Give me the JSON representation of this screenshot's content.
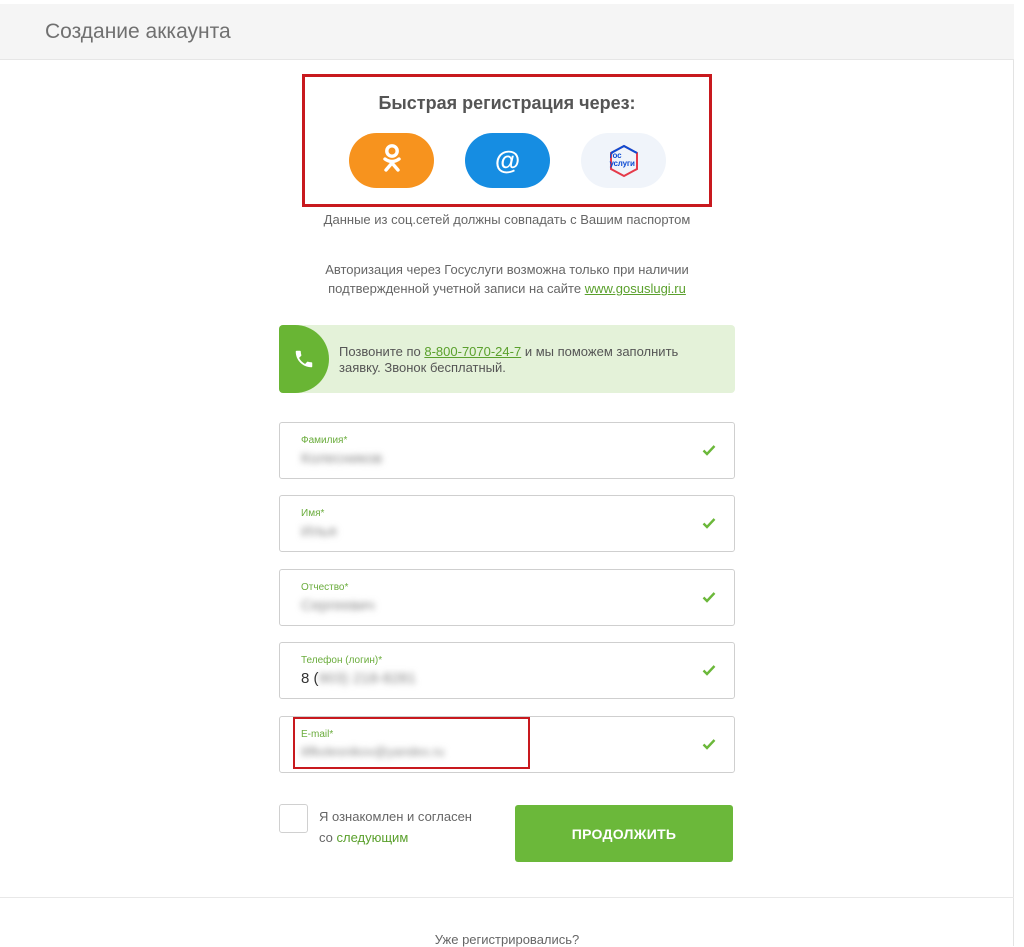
{
  "header": {
    "title": "Создание аккаунта"
  },
  "quick_register": {
    "title": "Быстрая регистрация через:",
    "buttons": [
      {
        "icon": "odnoklassniki-icon",
        "color": "#f7931e"
      },
      {
        "icon": "mail-at-icon",
        "glyph": "@",
        "color": "#168de2"
      },
      {
        "icon": "gosuslugi-icon",
        "logo_text_line1": "гос",
        "logo_text_line2": "услуги"
      }
    ]
  },
  "notes": {
    "social_note": "Данные из соц.сетей должны совпадать с Вашим паспортом",
    "gosuslugi_note_before": "Авторизация через Госуслуги возможна только при наличии подтвержденной учетной записи на сайте ",
    "gosuslugi_link": "www.gosuslugi.ru"
  },
  "call_banner": {
    "text_before": "Позвоните по ",
    "phone": "8-800-7070-24-7",
    "text_after": " и мы поможем заполнить заявку. Звонок бесплатный."
  },
  "form": {
    "fields": [
      {
        "label": "Фамилия*",
        "value": "Колесников"
      },
      {
        "label": "Имя*",
        "value": "Илья"
      },
      {
        "label": "Отчество*",
        "value": "Сергеевич"
      },
      {
        "label": "Телефон (логин)*",
        "value_prefix": "8 (",
        "value": "903) 218-8281"
      },
      {
        "label": "E-mail*",
        "value": "ilifkolesnikov@yandex.ru"
      }
    ],
    "agree_text_line1": "Я ознакомлен и согласен",
    "agree_text_line2_prefix": "со ",
    "agree_link": "следующим",
    "continue_label": "ПРОДОЛЖИТЬ"
  },
  "footer": {
    "already_registered": "Уже регистрировались?"
  },
  "colors": {
    "accent_green": "#6bb83a",
    "highlight_red": "#c8191e"
  }
}
